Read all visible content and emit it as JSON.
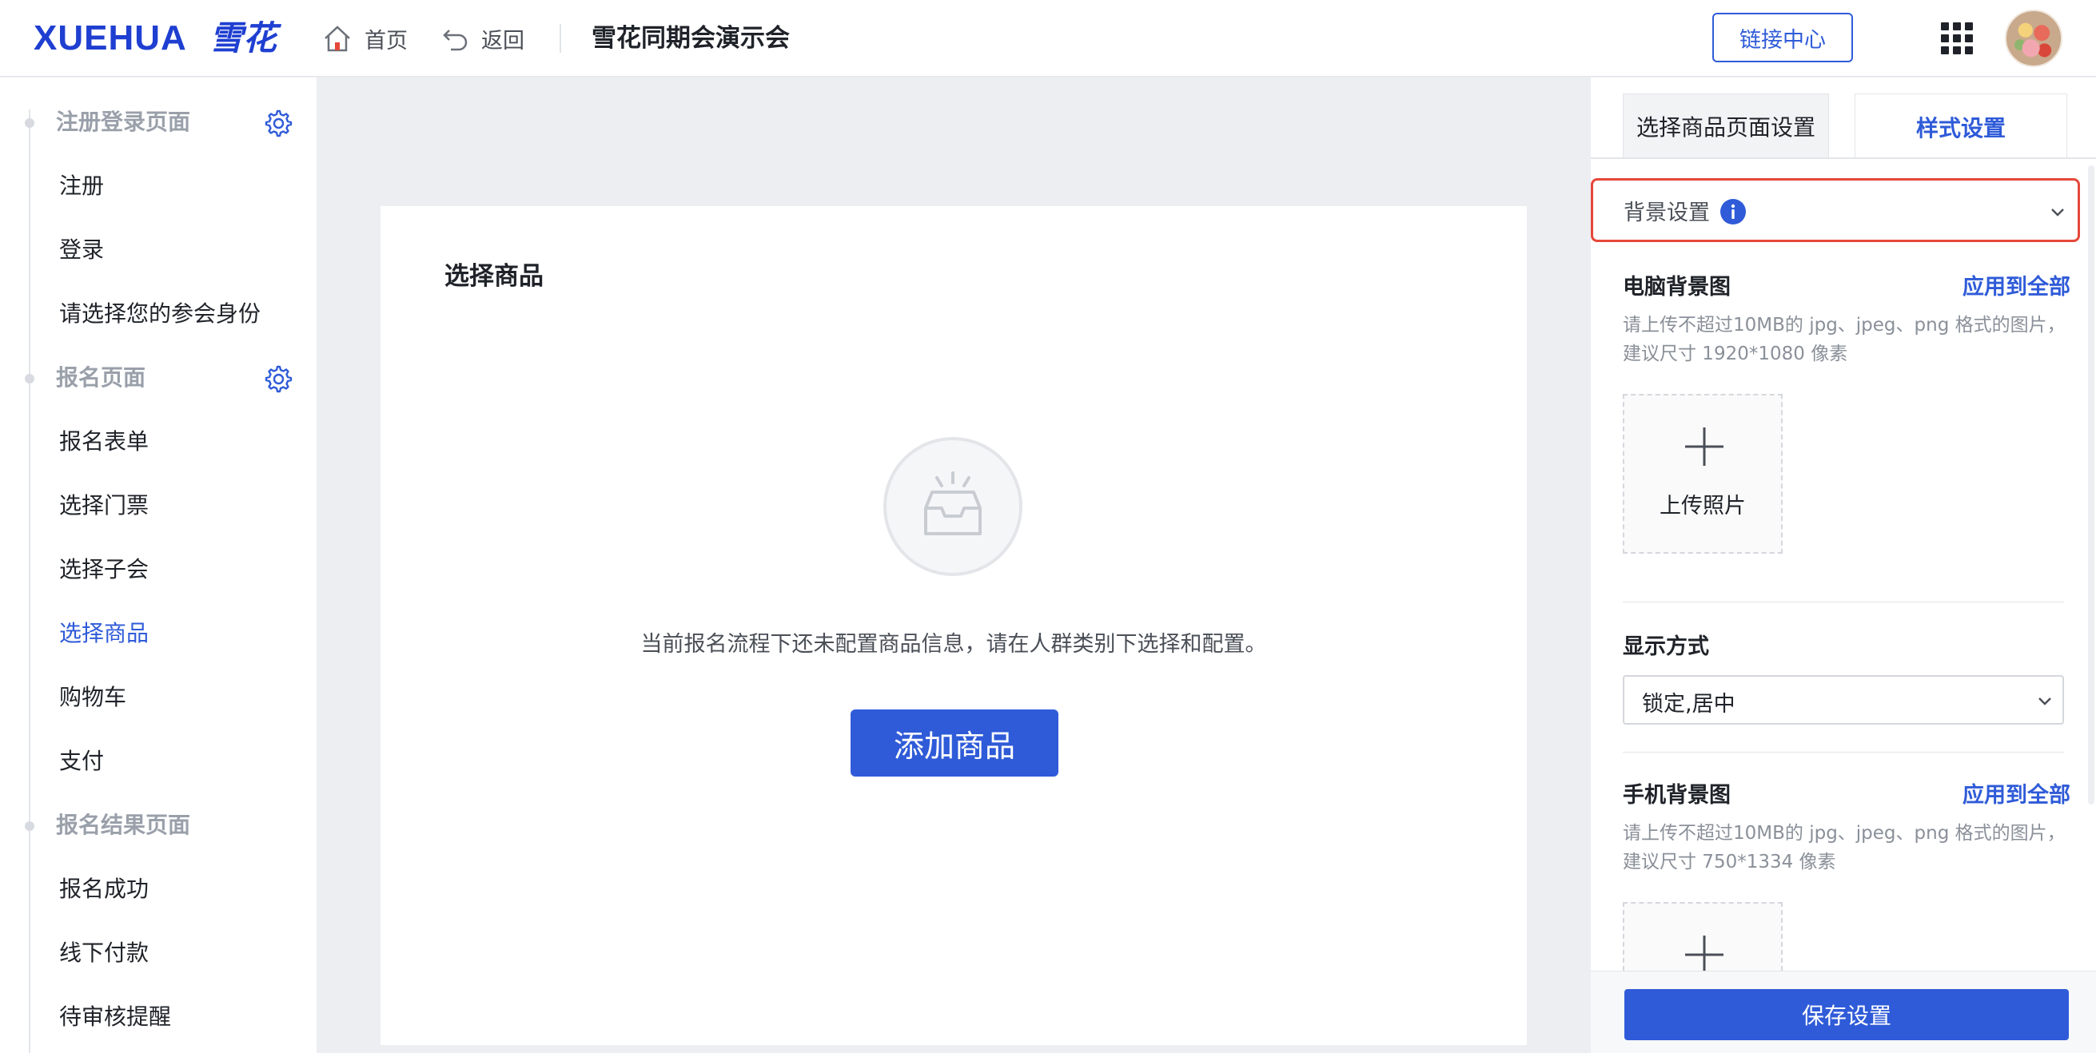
{
  "header": {
    "logo_en": "XUEHUA",
    "logo_cn": "雪花",
    "home_label": "首页",
    "back_label": "返回",
    "event_title": "雪花同期会演示会",
    "link_center_label": "链接中心",
    "home_icon": "home-icon",
    "back_icon": "undo-arrow-icon",
    "apps_icon": "grid-apps-icon"
  },
  "sidebar": {
    "sections": [
      {
        "label": "注册登录页面",
        "items": [
          "注册",
          "登录",
          "请选择您的参会身份"
        ]
      },
      {
        "label": "报名页面",
        "items": [
          "报名表单",
          "选择门票",
          "选择子会",
          "选择商品",
          "购物车",
          "支付"
        ]
      },
      {
        "label": "报名结果页面",
        "items": [
          "报名成功",
          "线下付款",
          "待审核提醒"
        ]
      }
    ],
    "active_item": "选择商品",
    "accent_color": "#2f5bd8"
  },
  "main": {
    "title": "选择商品",
    "empty_text": "当前报名流程下还未配置商品信息，请在人群类别下选择和配置。",
    "add_button": "添加商品",
    "empty_icon": "empty-inbox-icon"
  },
  "panel": {
    "tabs": [
      "选择商品页面设置",
      "样式设置"
    ],
    "active_tab": "样式设置",
    "bg_settings_label": "背景设置",
    "pc_bg": {
      "label": "电脑背景图",
      "apply_all": "应用到全部",
      "hint": "请上传不超过10MB的 jpg、jpeg、png 格式的图片，建议尺寸 1920*1080 像素",
      "upload_label": "上传照片"
    },
    "display_mode": {
      "label": "显示方式",
      "value": "锁定,居中"
    },
    "mobile_bg": {
      "label": "手机背景图",
      "apply_all": "应用到全部",
      "hint": "请上传不超过10MB的 jpg、jpeg、png 格式的图片，建议尺寸 750*1334 像素"
    },
    "save_button": "保存设置",
    "highlight_color": "#e5483a"
  }
}
